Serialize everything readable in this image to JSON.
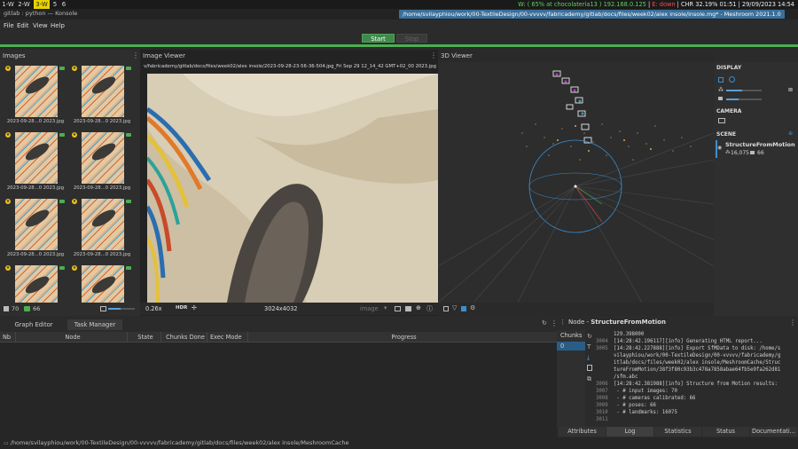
{
  "system_bar": {
    "workspaces": [
      "1-W",
      "2-W",
      "3-W",
      "5",
      "6"
    ],
    "active_workspace": "3-W",
    "status_wifi": "W: ( 65% at chocolateria13 ) 192.168.0.125",
    "status_eth": "E: down",
    "status_rest": "CHR 32.19% 01:51 | 29/09/2023 14:54"
  },
  "window": {
    "left_title": "gitlab : python — Konsole",
    "title": "/home/svilayphiou/work/00-TextileDesign/00-vvvvv/fabricademy/gitlab/docs/files/week02/alex insole/insole.mg* - Meshroom 2021.1.0"
  },
  "menu": [
    "File",
    "Edit",
    "View",
    "Help"
  ],
  "toolbar": {
    "start_label": "Start",
    "stop_label": "Stop"
  },
  "images_pane": {
    "title": "Images",
    "thumb_captions": [
      "2023-09-28...0 2023.jpg",
      "2023-09-28...0 2023.jpg",
      "2023-09-28...0 2023.jpg",
      "2023-09-28...0 2023.jpg",
      "2023-09-28...0 2023.jpg",
      "2023-09-28...0 2023.jpg",
      "",
      ""
    ],
    "image_count": "70",
    "camera_count": "66"
  },
  "image_viewer": {
    "title": "Image Viewer",
    "path": "v/fabricademy/gitlab/docs/files/week02/alex insole/2023-09-28-23-56-36-504.jpg_Fri Sep 29 12_14_42 GMT+02_00 2023.jpg",
    "zoom": "0.26x",
    "hdr": "HDR",
    "resolution": "3024x4032",
    "mode": "image"
  },
  "threed_viewer": {
    "title": "3D Viewer"
  },
  "side_panel": {
    "display_label": "DISPLAY",
    "camera_label": "CAMERA",
    "scene_label": "SCENE",
    "scene_item": "StructureFromMotion",
    "points": "16,075",
    "cameras": "66"
  },
  "graph_pane": {
    "tabs": [
      "Graph Editor",
      "Task Manager"
    ],
    "selected_tab": "Task Manager",
    "columns": [
      "Nb",
      "Node",
      "State",
      "Chunks Done",
      "Exec Mode",
      "Progress"
    ]
  },
  "node_pane": {
    "title_prefix": "Node - ",
    "title_node": "StructureFromMotion",
    "chunks_label": "Chunks",
    "chunk_index": "0",
    "log": [
      {
        "n": "",
        "t": "129.398000"
      },
      {
        "n": "3004",
        "t": "[14:28:42.196117][info] Generating HTML report..."
      },
      {
        "n": "3005",
        "t": "[14:28:42.227888][info] Export SfMData to disk: /home/s"
      },
      {
        "n": "",
        "t": "vilayphiou/work/00-TextileDesign/00-vvvvv/fabricademy/g"
      },
      {
        "n": "",
        "t": "itlab/docs/files/week02/alex insole/MeshroomCache/Struc"
      },
      {
        "n": "",
        "t": "tureFromMotion/38f3f80c93b3c478a7858abae64fb5e9fa262d81"
      },
      {
        "n": "",
        "t": "/sfm.abc"
      },
      {
        "n": "3006",
        "t": "[14:28:42.381988][info] Structure from Motion results:"
      },
      {
        "n": "3007",
        "t": "        - # input images: 70"
      },
      {
        "n": "3008",
        "t": "        - # cameras calibrated: 66"
      },
      {
        "n": "3009",
        "t": "        - # poses: 66"
      },
      {
        "n": "3010",
        "t": "        - # landmarks: 16075"
      },
      {
        "n": "3011",
        "t": ""
      }
    ],
    "tabs": [
      "Attributes",
      "Log",
      "Statistics",
      "Status",
      "Documentati..."
    ],
    "selected_tab": "Log"
  },
  "status_bar": {
    "path": "/home/svilayphiou/work/00-TextileDesign/00-vvvvv/fabricademy/gitlab/docs/files/week02/alex insole/MeshroomCache"
  },
  "colors": {
    "accent_green": "#4caf50",
    "selection_blue": "#3a6f9a",
    "workspace_yellow": "#e8d200"
  }
}
